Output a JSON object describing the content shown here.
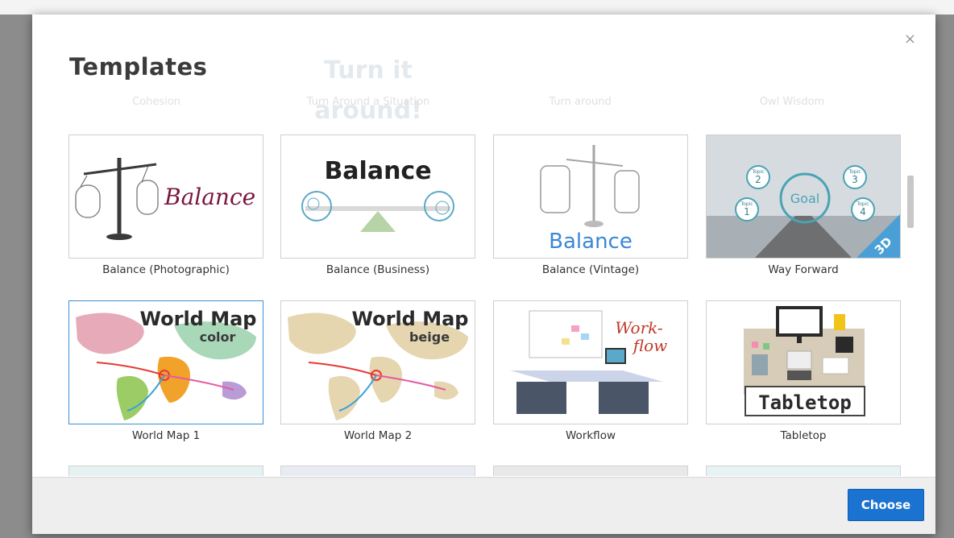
{
  "modal": {
    "title": "Templates",
    "close_glyph": "×",
    "choose_label": "Choose",
    "colors": {
      "primary": "#1a73d0",
      "selected_border": "#3c8fd6"
    }
  },
  "ghost_row": [
    {
      "image_text": "",
      "label": "Cohesion"
    },
    {
      "image_text": "Turn it around!",
      "label": "Turn Around a Situation"
    },
    {
      "image_text": "",
      "label": "Turn around"
    },
    {
      "image_text": "",
      "label": "Owl Wisdom"
    }
  ],
  "templates": [
    {
      "label": "Balance (Photographic)",
      "image_text": "Balance"
    },
    {
      "label": "Balance (Business)",
      "image_text": "Balance"
    },
    {
      "label": "Balance (Vintage)",
      "image_text": "Balance"
    },
    {
      "label": "Way Forward",
      "image_text": "Goal",
      "badge": "3D",
      "topics": [
        {
          "word": "Topic",
          "num": "1"
        },
        {
          "word": "Topic",
          "num": "2"
        },
        {
          "word": "Topic",
          "num": "3"
        },
        {
          "word": "Topic",
          "num": "4"
        }
      ]
    },
    {
      "label": "World Map 1",
      "image_text": "World Map",
      "image_sub": "color"
    },
    {
      "label": "World Map 2",
      "image_text": "World Map",
      "image_sub": "beige"
    },
    {
      "label": "Workflow",
      "image_text": "Work-",
      "image_sub": "flow"
    },
    {
      "label": "Tabletop",
      "image_text": "Tabletop"
    }
  ]
}
